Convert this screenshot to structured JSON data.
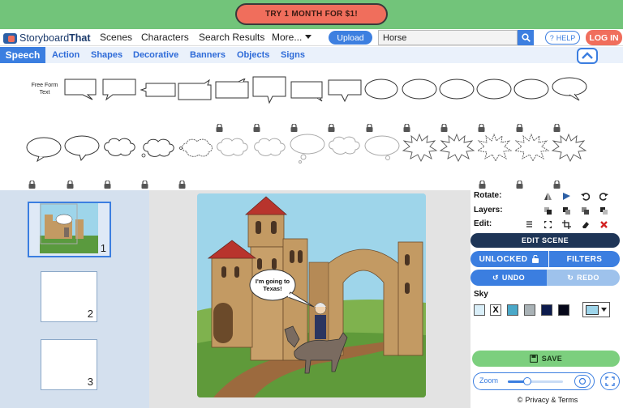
{
  "promo": {
    "label": "TRY 1 MONTH FOR $1!"
  },
  "brand": {
    "part1": "Storyboard",
    "part2": "That"
  },
  "nav": {
    "scenes": "Scenes",
    "characters": "Characters",
    "search_results": "Search Results",
    "more": "More..."
  },
  "upload_label": "Upload",
  "search": {
    "value": "Horse"
  },
  "help_label": "HELP",
  "login_label": "LOG IN",
  "tabs": [
    "Speech",
    "Action",
    "Shapes",
    "Decorative",
    "Banners",
    "Objects",
    "Signs"
  ],
  "freeform": {
    "line1": "Free Form",
    "line2": "Text"
  },
  "storyboard": {
    "cells": [
      "1",
      "2",
      "3"
    ]
  },
  "scene": {
    "bubble_text": "I'm going to Texas!"
  },
  "controls": {
    "rotate": "Rotate:",
    "layers": "Layers:",
    "edit": "Edit:",
    "edit_scene": "EDIT SCENE",
    "unlocked": "UNLOCKED",
    "filters": "FILTERS",
    "undo": "UNDO",
    "redo": "REDO",
    "sky": "Sky",
    "save": "SAVE",
    "zoom": "Zoom",
    "privacy": "Privacy & Terms"
  },
  "sky_colors": [
    "#d9eef8",
    "#ffffff",
    "#4aa8c8",
    "#a9b2b6",
    "#0d1b4d",
    "#06081a"
  ],
  "sky_selected": "#9ed5ea",
  "zoom_level": 0.35,
  "colors": {
    "accent": "#3b7ee0",
    "promo": "#f06e5c",
    "green": "#72c47a",
    "navy": "#1e3557"
  }
}
